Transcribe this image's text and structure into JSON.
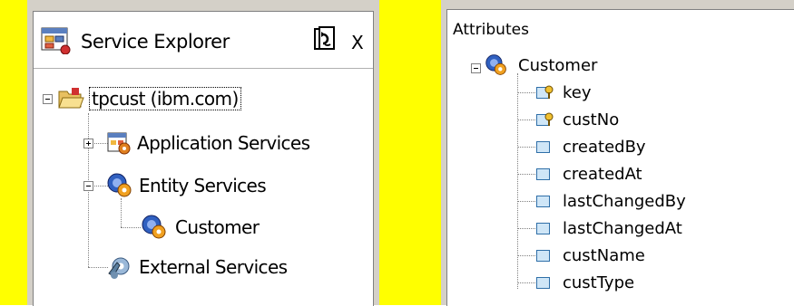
{
  "explorer": {
    "title": "Service Explorer",
    "close_label": "X",
    "tree": {
      "root": "tpcust (ibm.com)",
      "items": [
        {
          "label": "Application Services"
        },
        {
          "label": "Entity Services",
          "children": [
            {
              "label": "Customer"
            }
          ]
        },
        {
          "label": "External Services"
        }
      ]
    }
  },
  "attributes": {
    "title": "Attributes",
    "root": "Customer",
    "items": [
      {
        "label": "key",
        "key": true
      },
      {
        "label": "custNo",
        "key": true
      },
      {
        "label": "createdBy",
        "key": false
      },
      {
        "label": "createdAt",
        "key": false
      },
      {
        "label": "lastChangedBy",
        "key": false
      },
      {
        "label": "lastChangedAt",
        "key": false
      },
      {
        "label": "custName",
        "key": false
      },
      {
        "label": "custType",
        "key": false
      }
    ]
  },
  "colors": {
    "highlight": "#ffff00",
    "panel": "#d4d0c8",
    "attr_icon_fill": "#cfe6f7",
    "attr_icon_border": "#2f6fa8"
  }
}
